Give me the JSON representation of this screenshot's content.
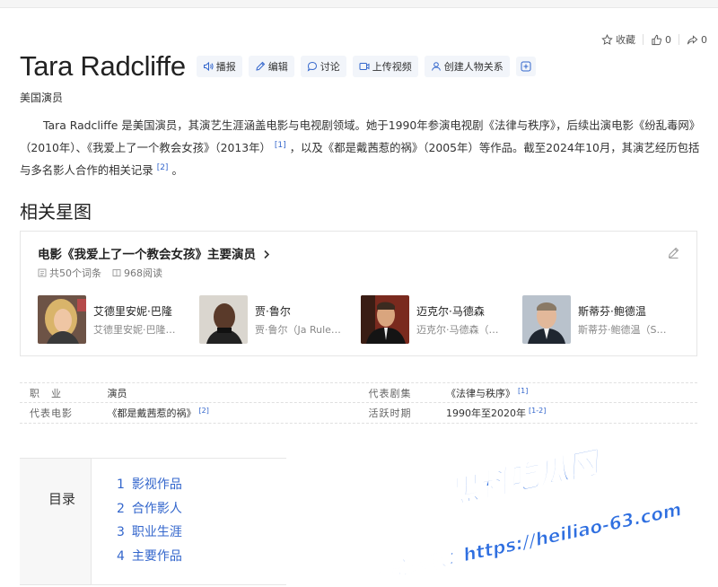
{
  "header": {
    "title": "Tara Radcliffe",
    "subtitle": "美国演员",
    "tools": [
      "播报",
      "编辑",
      "讨论",
      "上传视频",
      "创建人物关系"
    ],
    "actions": {
      "collect": "收藏",
      "likes": "0",
      "shares": "0"
    }
  },
  "summary": {
    "part1": "Tara Radcliffe 是美国演员，其演艺生涯涵盖电影与电视剧领域。她于1990年参演电视剧《法律与秩序》，后续出演电影《纷乱毒网》（2010年）、《我爱上了一个教会女孩》（2013年）",
    "ref1": "[1]",
    "part2": "，以及《都是戴茜惹的祸》（2005年）等作品。截至2024年10月，其演艺经历包括与多名影人合作的相关记录",
    "ref2": "[2]",
    "part3": "。"
  },
  "section": {
    "title": "相关星图"
  },
  "card": {
    "title": "电影《我爱上了一个教会女孩》主要演员",
    "entries": "共50个词条",
    "reads": "968阅读",
    "people": [
      {
        "name": "艾德里安妮·巴隆",
        "sub": "艾德里安妮·巴隆…"
      },
      {
        "name": "贾·鲁尔",
        "sub": "贾·鲁尔（Ja Rule…"
      },
      {
        "name": "迈克尔·马德森",
        "sub": "迈克尔·马德森（M…"
      },
      {
        "name": "斯蒂芬·鲍德温",
        "sub": "斯蒂芬·鲍德温（S…"
      }
    ]
  },
  "info": {
    "rows": [
      {
        "l1": "职　业",
        "v1": "演员",
        "r1": "",
        "l2": "代表剧集",
        "v2": "《法律与秩序》",
        "r2": "[1]"
      },
      {
        "l1": "代表电影",
        "v1": "《都是戴茜惹的祸》",
        "r1": "[2]",
        "l2": "活跃时期",
        "v2": "1990年至2020年",
        "r2": "[1-2]"
      }
    ]
  },
  "toc": {
    "title": "目录",
    "items": [
      {
        "num": "1",
        "label": "影视作品"
      },
      {
        "num": "2",
        "label": "合作影人"
      },
      {
        "num": "3",
        "label": "职业生涯"
      },
      {
        "num": "4",
        "label": "主要作品"
      }
    ]
  },
  "watermark": {
    "line1": "黑料吃瓜网",
    "line2": "看完整版：https://heiliao-63.com"
  },
  "colors": {
    "link": "#3366cc",
    "watermark": "#2f6fe0"
  }
}
